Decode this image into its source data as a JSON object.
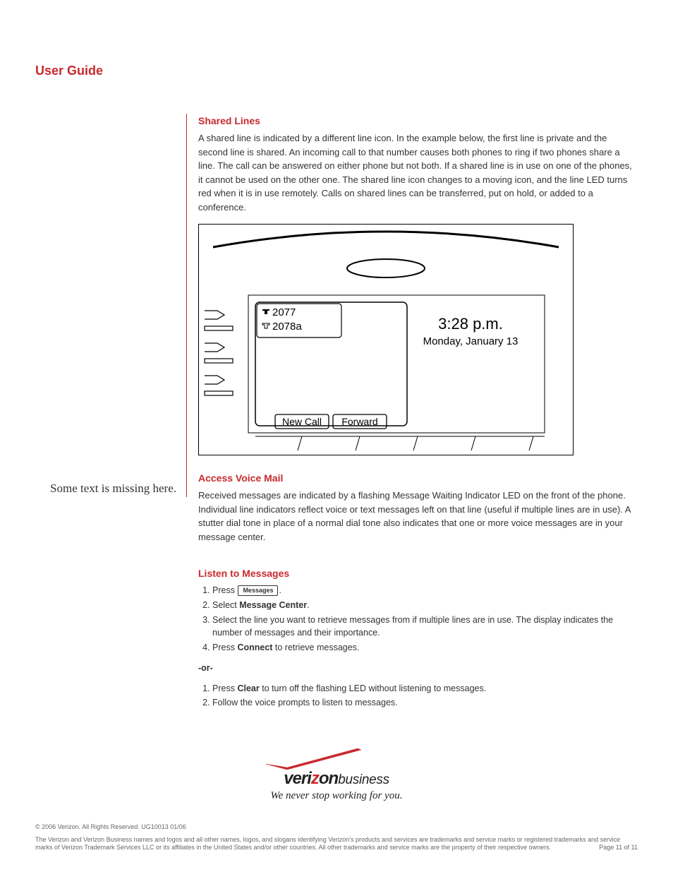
{
  "header": {
    "title": "User Guide"
  },
  "margin": {
    "note": "Some text is missing here."
  },
  "section1": {
    "heading": "Shared Lines",
    "body": "A shared line is indicated by a different line icon. In the example below, the first line is private and the second line is shared. An incoming call to that number causes both phones to ring if two phones share a line. The call can be answered on either phone but not both. If a shared line is in use on one of the phones, it cannot be used on the other one. The shared line icon changes to a moving icon, and the line LED turns red when it is in use remotely. Calls on shared lines can be transferred, put on hold, or added to a conference."
  },
  "illustration": {
    "line1": "2077",
    "line2": "2078a",
    "time": "3:28 p.m.",
    "date": "Monday, January 13",
    "softkey1": "New Call",
    "softkey2": "Forward"
  },
  "section2": {
    "heading": "Access Voice Mail",
    "body": "Received messages are indicated by a flashing Message Waiting Indicator LED on the front of the phone. Individual line indicators reflect voice or text messages left on that line (useful if multiple lines are in use). A stutter dial tone in place of a normal dial tone also indicates that one or more voice messages are in your message center."
  },
  "section3": {
    "heading": "Listen to Messages",
    "step1_a": "Press",
    "step1_b": ".",
    "key_messages": "Messages",
    "step2_a": "Select ",
    "step2_b": "Message Center",
    "step2_c": ".",
    "step3": "Select the line you want to retrieve messages from if multiple lines are in use. The display indicates the number of messages and their importance.",
    "step4_a": "Press ",
    "step4_b": "Connect",
    "step4_c": " to retrieve messages.",
    "or": "-or-",
    "alt1_a": "Press ",
    "alt1_b": "Clear",
    "alt1_c": " to turn off the flashing LED without listening to messages.",
    "alt2": "Follow the voice prompts to listen to messages."
  },
  "logo": {
    "veri": "veri",
    "z": "z",
    "on": "on",
    "business": "business",
    "tagline": "We never stop working for you."
  },
  "footer": {
    "copyright": "© 2006 Verizon. All Rights Reserved. UG10013 01/06",
    "trademark": "The Verizon and Verizon Business names and logos and all other names, logos, and slogans identifying Verizon's products and services are trademarks and service marks or registered trademarks and service marks of Verizon Trademark Services LLC or its affiliates in the United States and/or other countries. All other trademarks and service marks are the property of their respective owners.",
    "page": "Page 11 of 11"
  }
}
